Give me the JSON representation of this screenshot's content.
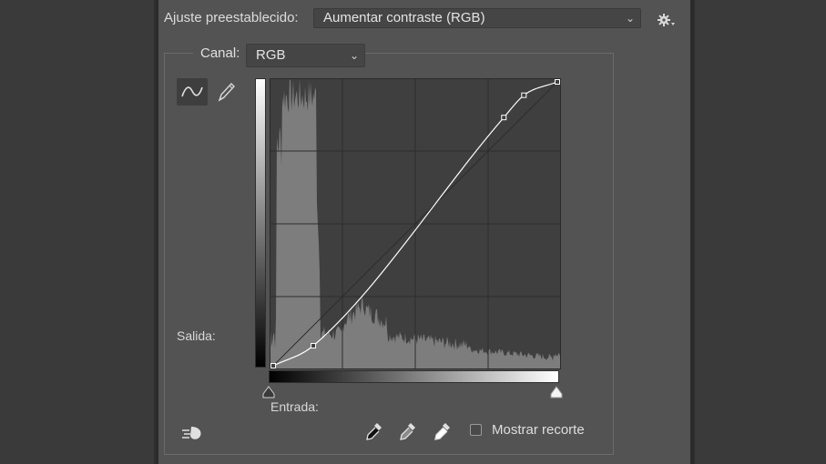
{
  "preset": {
    "label": "Ajuste preestablecido:",
    "value": "Aumentar contraste (RGB)"
  },
  "channel": {
    "label": "Canal:",
    "value": "RGB"
  },
  "labels": {
    "output": "Salida:",
    "input": "Entrada:",
    "show_clipping": "Mostrar recorte"
  },
  "show_clipping_checked": false,
  "icons": {
    "preset_options": "gear-icon",
    "curve_tool": "curve-tool-icon",
    "pencil_tool": "pencil-icon",
    "smooth": "smooth-curve-icon",
    "black_point": "eyedropper-black-icon",
    "gray_point": "eyedropper-gray-icon",
    "white_point": "eyedropper-white-icon"
  },
  "curve_points": [
    [
      0,
      0
    ],
    [
      36,
      18
    ],
    [
      207,
      223
    ],
    [
      225,
      243
    ],
    [
      255,
      255
    ]
  ],
  "colors": {
    "panel": "#535353",
    "graph_bg": "#3f3f3f",
    "histogram": "#7d7d7d",
    "curve": "#ffffff",
    "grid": "#2d2d2d"
  }
}
